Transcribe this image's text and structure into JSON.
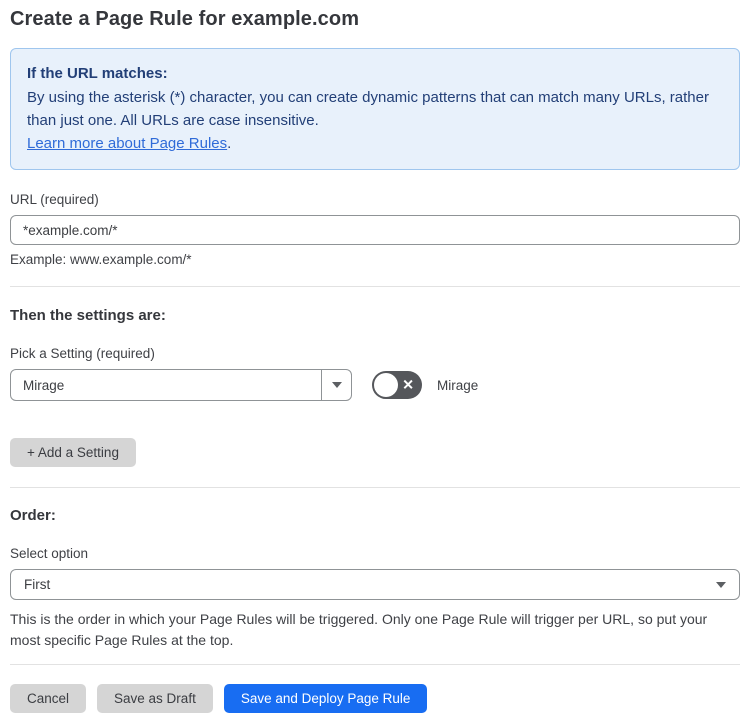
{
  "page": {
    "title": "Create a Page Rule for example.com"
  },
  "info_box": {
    "heading": "If the URL matches:",
    "body": "By using the asterisk (*) character, you can create dynamic patterns that can match many URLs, rather than just one. All URLs are case insensitive.",
    "link_label": "Learn more about Page Rules",
    "link_suffix": "."
  },
  "url_field": {
    "label": "URL (required)",
    "value": "*example.com/*",
    "hint": "Example: www.example.com/*"
  },
  "settings_section": {
    "heading": "Then the settings are:",
    "picker_label": "Pick a Setting (required)",
    "selected_setting": "Mirage",
    "toggle": {
      "state": "off",
      "off_glyph": "✕",
      "label": "Mirage"
    },
    "add_setting_label": "+ Add a Setting"
  },
  "order_section": {
    "heading": "Order:",
    "select_label": "Select option",
    "selected_option": "First",
    "description": "This is the order in which your Page Rules will be triggered. Only one Page Rule will trigger per URL, so put your most specific Page Rules at the top."
  },
  "footer": {
    "cancel_label": "Cancel",
    "save_draft_label": "Save as Draft",
    "save_deploy_label": "Save and Deploy Page Rule"
  },
  "colors": {
    "accent_blue": "#186df2",
    "info_bg": "#e8f1fb",
    "info_border": "#9fc6ee",
    "info_text": "#223f77",
    "link_blue": "#2f6bd8",
    "toggle_off_bg": "#55575b",
    "button_gray": "#d5d5d5"
  }
}
